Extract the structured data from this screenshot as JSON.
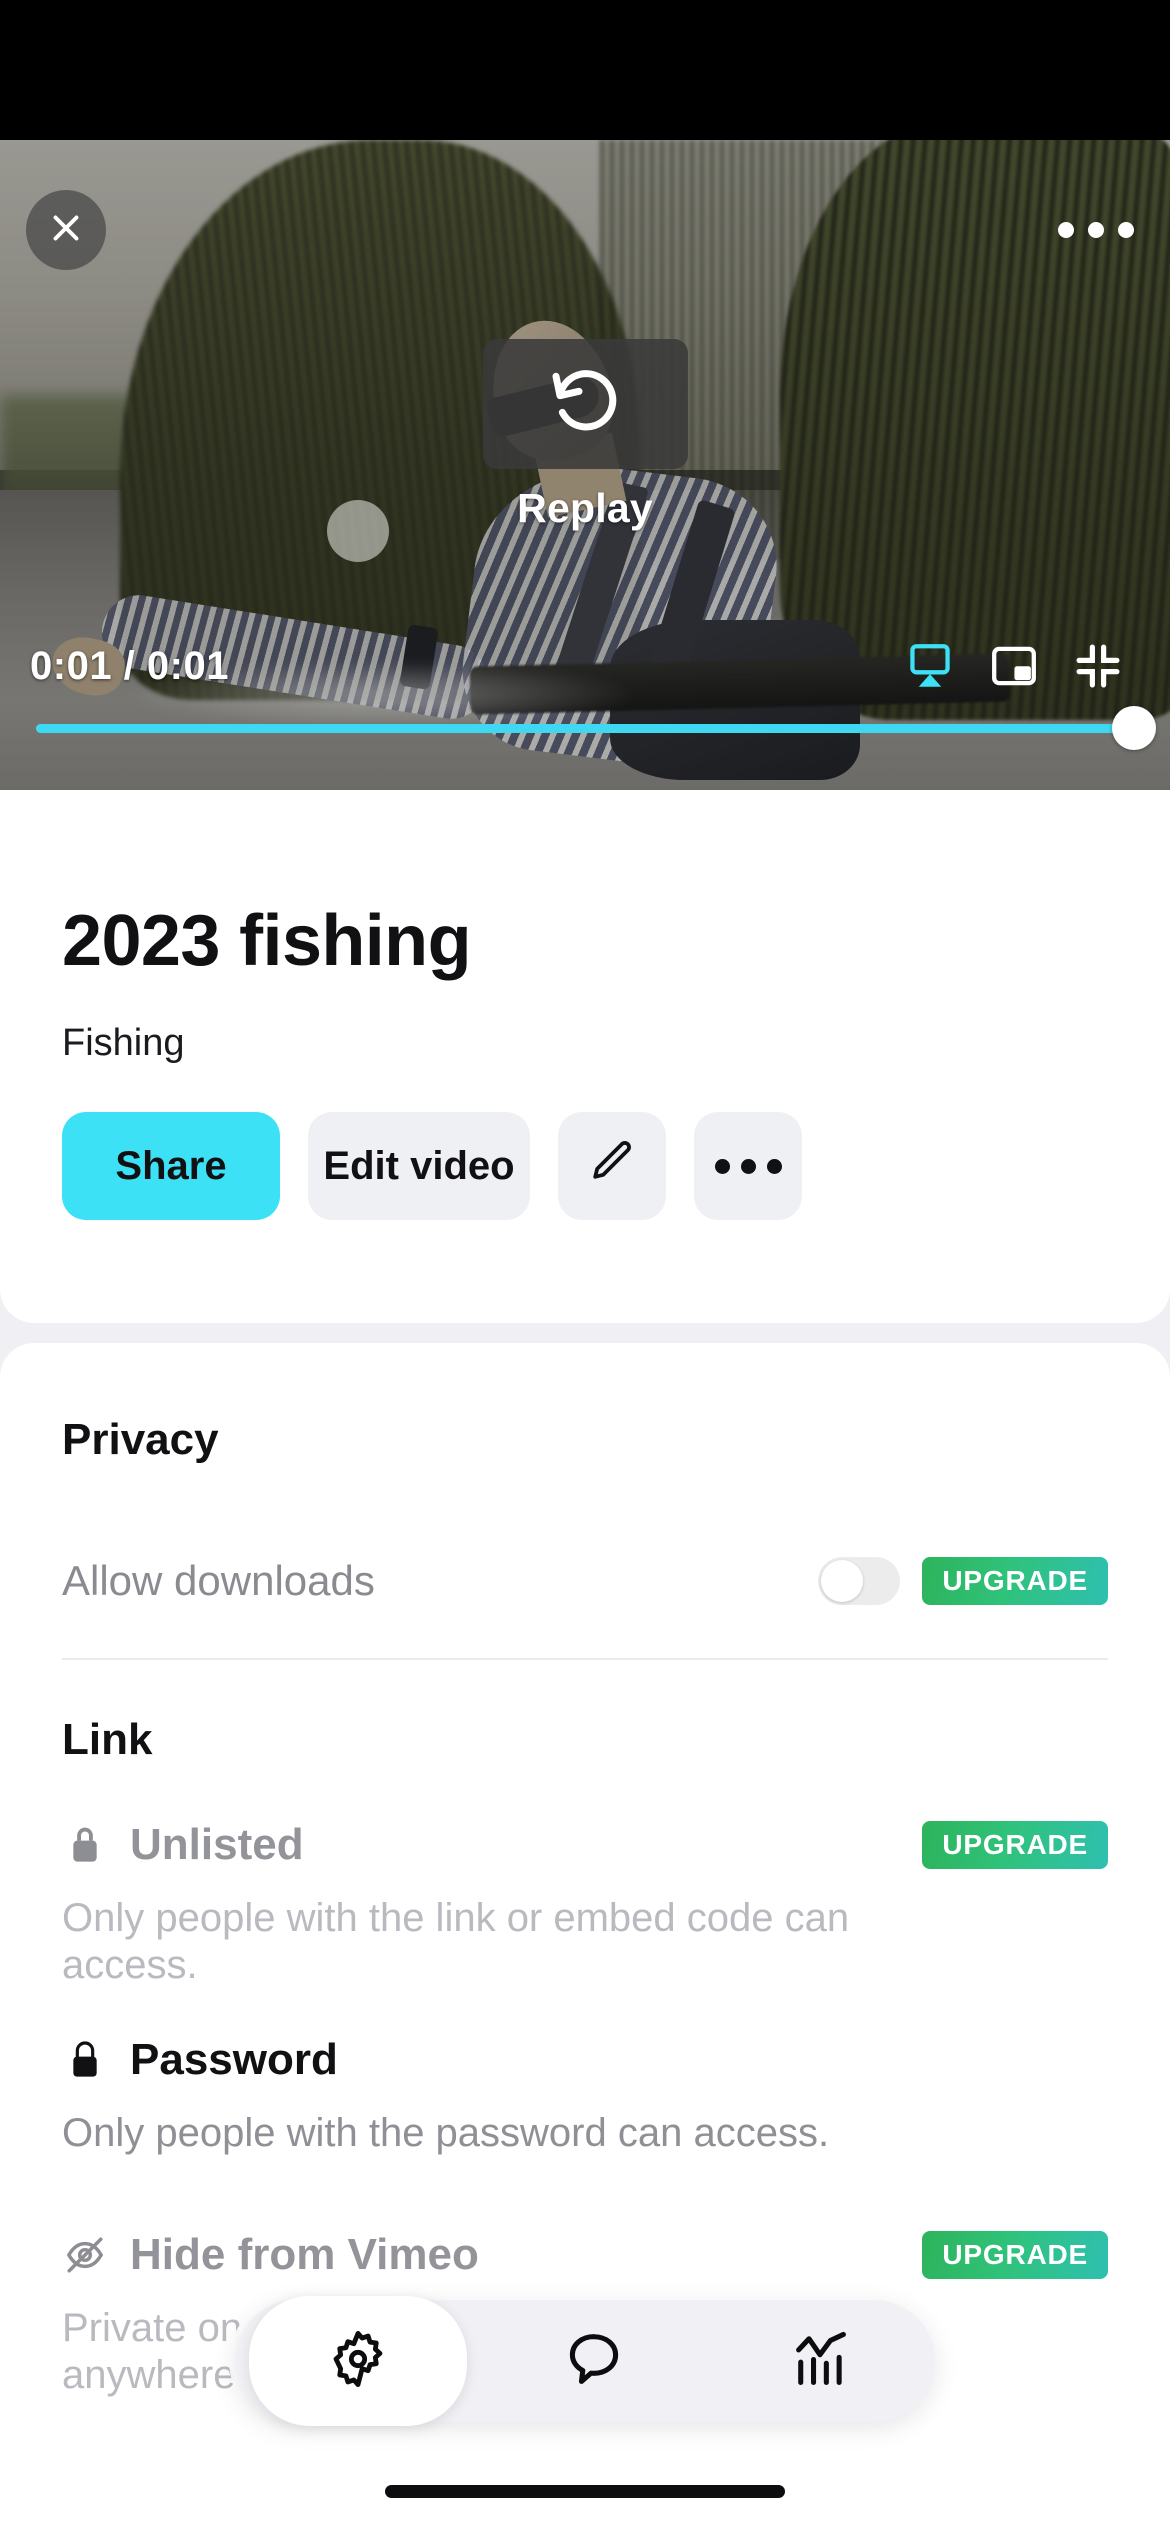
{
  "player": {
    "close_icon": "close-icon",
    "more_icon": "more-options-icon",
    "replay_icon": "replay-rotate-ccw-icon",
    "replay_label": "Replay",
    "time_display": "0:01 / 0:01",
    "current_time": "0:01",
    "duration": "0:01",
    "progress_percent": 100,
    "airplay_icon": "airplay-icon",
    "pip_icon": "picture-in-picture-icon",
    "fullscreen_exit_icon": "exit-fullscreen-icon",
    "accent_color": "#3ce1f5"
  },
  "video": {
    "title": "2023 fishing",
    "subtitle": "Fishing"
  },
  "actions": {
    "share_label": "Share",
    "edit_label": "Edit video",
    "pencil_icon": "pencil-edit-icon",
    "more_icon": "more-horizontal-icon"
  },
  "privacy": {
    "heading": "Privacy",
    "allow_downloads_label": "Allow downloads",
    "allow_downloads_on": false,
    "upgrade_label": "UPGRADE"
  },
  "link": {
    "heading": "Link",
    "options": [
      {
        "icon": "lock-icon",
        "name": "Unlisted",
        "description": "Only people with the link or embed code can access.",
        "disabled": true,
        "upgrade_label": "UPGRADE"
      },
      {
        "icon": "lock-password-icon",
        "name": "Password",
        "description": "Only people with the password can access.",
        "disabled": false,
        "upgrade_label": ""
      },
      {
        "icon": "eye-off-icon",
        "name": "Hide from Vimeo",
        "description": "Private on your account, but embeddable anywhere.",
        "disabled": true,
        "upgrade_label": "UPGRADE"
      }
    ]
  },
  "tabbar": {
    "tabs": [
      {
        "icon": "gear-settings-icon",
        "selected": true
      },
      {
        "icon": "comment-bubble-icon",
        "selected": false
      },
      {
        "icon": "analytics-stats-icon",
        "selected": false
      }
    ]
  },
  "colors": {
    "accent": "#3ce1f5",
    "upgrade_start": "#2eb35b",
    "upgrade_end": "#2fc0b0",
    "muted_text": "#93939a"
  }
}
